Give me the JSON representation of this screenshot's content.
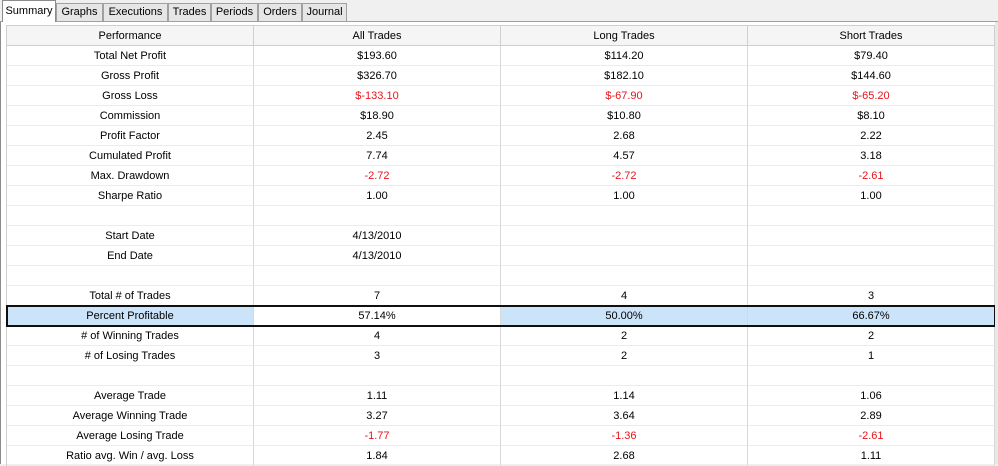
{
  "tabs": [
    "Summary",
    "Graphs",
    "Executions",
    "Trades",
    "Periods",
    "Orders",
    "Journal"
  ],
  "active_tab": "Summary",
  "columns": [
    "Performance",
    "All Trades",
    "Long Trades",
    "Short Trades"
  ],
  "rows": [
    {
      "label": "Total Net Profit",
      "values": [
        "$193.60",
        "$114.20",
        "$79.40"
      ],
      "neg": false
    },
    {
      "label": "Gross Profit",
      "values": [
        "$326.70",
        "$182.10",
        "$144.60"
      ],
      "neg": false
    },
    {
      "label": "Gross Loss",
      "values": [
        "$-133.10",
        "$-67.90",
        "$-65.20"
      ],
      "neg": true
    },
    {
      "label": "Commission",
      "values": [
        "$18.90",
        "$10.80",
        "$8.10"
      ],
      "neg": false
    },
    {
      "label": "Profit Factor",
      "values": [
        "2.45",
        "2.68",
        "2.22"
      ],
      "neg": false
    },
    {
      "label": "Cumulated Profit",
      "values": [
        "7.74",
        "4.57",
        "3.18"
      ],
      "neg": false
    },
    {
      "label": "Max. Drawdown",
      "values": [
        "-2.72",
        "-2.72",
        "-2.61"
      ],
      "neg": true
    },
    {
      "label": "Sharpe Ratio",
      "values": [
        "1.00",
        "1.00",
        "1.00"
      ],
      "neg": false
    },
    {
      "label": "",
      "values": [
        "",
        "",
        ""
      ],
      "neg": false
    },
    {
      "label": "Start Date",
      "values": [
        "4/13/2010",
        "",
        ""
      ],
      "neg": false
    },
    {
      "label": "End Date",
      "values": [
        "4/13/2010",
        "",
        ""
      ],
      "neg": false
    },
    {
      "label": "",
      "values": [
        "",
        "",
        ""
      ],
      "neg": false
    },
    {
      "label": "Total # of Trades",
      "values": [
        "7",
        "4",
        "3"
      ],
      "neg": false
    },
    {
      "label": "Percent Profitable",
      "values": [
        "57.14%",
        "50.00%",
        "66.67%"
      ],
      "neg": false,
      "selected": true
    },
    {
      "label": "# of Winning Trades",
      "values": [
        "4",
        "2",
        "2"
      ],
      "neg": false
    },
    {
      "label": "# of Losing Trades",
      "values": [
        "3",
        "2",
        "1"
      ],
      "neg": false
    },
    {
      "label": "",
      "values": [
        "",
        "",
        ""
      ],
      "neg": false
    },
    {
      "label": "Average Trade",
      "values": [
        "1.11",
        "1.14",
        "1.06"
      ],
      "neg": false
    },
    {
      "label": "Average Winning Trade",
      "values": [
        "3.27",
        "3.64",
        "2.89"
      ],
      "neg": false
    },
    {
      "label": "Average Losing Trade",
      "values": [
        "-1.77",
        "-1.36",
        "-2.61"
      ],
      "neg": true
    },
    {
      "label": "Ratio avg. Win / avg. Loss",
      "values": [
        "1.84",
        "2.68",
        "1.11"
      ],
      "neg": false
    }
  ]
}
